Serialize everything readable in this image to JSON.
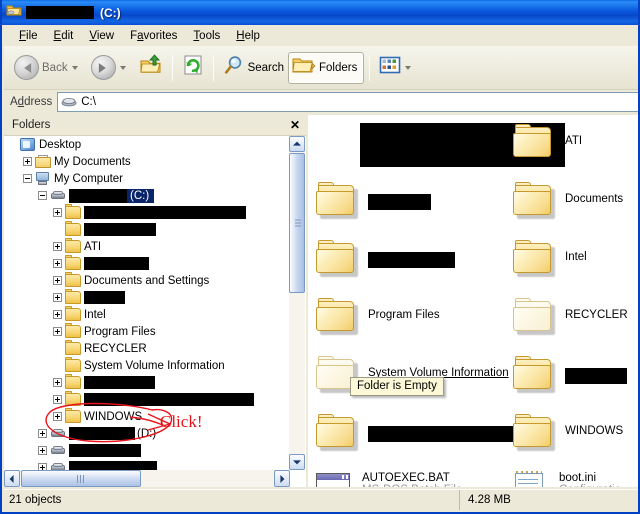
{
  "window": {
    "title_suffix": "(C:)",
    "title_icon": "folder-drive-icon",
    "redacted_title_width": 68
  },
  "menubar": {
    "items": [
      {
        "accel": "F",
        "rest": "ile"
      },
      {
        "accel": "E",
        "rest": "dit"
      },
      {
        "accel": "V",
        "rest": "iew"
      },
      {
        "pre": "F",
        "accel": "a",
        "rest": "vorites"
      },
      {
        "accel": "T",
        "rest": "ools"
      },
      {
        "accel": "H",
        "rest": "elp"
      }
    ],
    "labels": [
      "File",
      "Edit",
      "View",
      "Favorites",
      "Tools",
      "Help"
    ]
  },
  "toolbar": {
    "back_label": "Back",
    "forward_label": "",
    "up_label": "",
    "refresh_label": "",
    "search_label": "Search",
    "folders_label": "Folders",
    "views_label": ""
  },
  "address": {
    "label_pre": "A",
    "label_accel": "d",
    "label_rest": "dress",
    "label": "Address",
    "value": "C:\\",
    "icon": "drive-icon"
  },
  "tree": {
    "header": "Folders",
    "close_label": "✕",
    "nodes": [
      {
        "indent": 0,
        "expander": "none",
        "icon": "desktop-icon",
        "label": "Desktop",
        "redacted": 0,
        "selected": false
      },
      {
        "indent": 1,
        "expander": "plus",
        "icon": "mydocs-icon",
        "label": "My Documents",
        "redacted": 0,
        "selected": false
      },
      {
        "indent": 1,
        "expander": "minus",
        "icon": "mycomputer-icon",
        "label": "My Computer",
        "redacted": 0,
        "selected": false
      },
      {
        "indent": 2,
        "expander": "minus",
        "icon": "drive-icon",
        "label": "(C:)",
        "redacted": 58,
        "selected": true
      },
      {
        "indent": 3,
        "expander": "plus",
        "icon": "folder-icon",
        "label": "",
        "redacted": 162,
        "selected": false
      },
      {
        "indent": 3,
        "expander": "none",
        "icon": "folder-icon",
        "label": "",
        "redacted": 72,
        "selected": false
      },
      {
        "indent": 3,
        "expander": "plus",
        "icon": "folder-icon",
        "label": "ATI",
        "redacted": 0,
        "selected": false
      },
      {
        "indent": 3,
        "expander": "plus",
        "icon": "folder-icon",
        "label": "",
        "redacted": 65,
        "selected": false
      },
      {
        "indent": 3,
        "expander": "plus",
        "icon": "folder-icon",
        "label": "Documents and Settings",
        "redacted": 0,
        "selected": false
      },
      {
        "indent": 3,
        "expander": "plus",
        "icon": "folder-icon",
        "label": "",
        "redacted": 41,
        "selected": false
      },
      {
        "indent": 3,
        "expander": "plus",
        "icon": "folder-icon",
        "label": "Intel",
        "redacted": 0,
        "selected": false
      },
      {
        "indent": 3,
        "expander": "plus",
        "icon": "folder-icon",
        "label": "Program Files",
        "redacted": 0,
        "selected": false
      },
      {
        "indent": 3,
        "expander": "none",
        "icon": "folder-icon",
        "label": "RECYCLER",
        "redacted": 0,
        "selected": false
      },
      {
        "indent": 3,
        "expander": "none",
        "icon": "folder-icon",
        "label": "System Volume Information",
        "redacted": 0,
        "selected": false
      },
      {
        "indent": 3,
        "expander": "plus",
        "icon": "folder-icon",
        "label": "",
        "redacted": 71,
        "selected": false
      },
      {
        "indent": 3,
        "expander": "plus",
        "icon": "folder-icon",
        "label": "",
        "redacted": 170,
        "selected": false
      },
      {
        "indent": 3,
        "expander": "plus",
        "icon": "folder-icon",
        "label": "WINDOWS",
        "redacted": 0,
        "selected": false
      },
      {
        "indent": 2,
        "expander": "plus",
        "icon": "drive-icon",
        "label": "(D:)",
        "redacted": 66,
        "selected": false
      },
      {
        "indent": 2,
        "expander": "plus",
        "icon": "drive-icon",
        "label": "",
        "redacted": 72,
        "selected": false
      },
      {
        "indent": 2,
        "expander": "plus",
        "icon": "drive-icon",
        "label": "",
        "redacted": 88,
        "selected": false
      }
    ]
  },
  "files": {
    "items": [
      {
        "col": 0,
        "row": 0,
        "name": "",
        "redacted": 205,
        "pale": false,
        "underline": false,
        "kind": "folder"
      },
      {
        "col": 1,
        "row": 0,
        "name": "ATI",
        "redacted": 0,
        "pale": false,
        "underline": false,
        "kind": "folder"
      },
      {
        "col": 0,
        "row": 1,
        "name": "",
        "redacted": 63,
        "pale": false,
        "underline": false,
        "kind": "folder"
      },
      {
        "col": 1,
        "row": 1,
        "name": "Documents ",
        "redacted": 0,
        "pale": false,
        "underline": false,
        "kind": "folder"
      },
      {
        "col": 0,
        "row": 2,
        "name": "",
        "redacted": 87,
        "pale": false,
        "underline": false,
        "kind": "folder"
      },
      {
        "col": 1,
        "row": 2,
        "name": "Intel",
        "redacted": 0,
        "pale": false,
        "underline": false,
        "kind": "folder"
      },
      {
        "col": 0,
        "row": 3,
        "name": "Program Files",
        "redacted": 0,
        "pale": false,
        "underline": false,
        "kind": "folder"
      },
      {
        "col": 1,
        "row": 3,
        "name": "RECYCLER",
        "redacted": 0,
        "pale": true,
        "underline": false,
        "kind": "folder"
      },
      {
        "col": 0,
        "row": 4,
        "name": "System Volume Information",
        "redacted": 0,
        "pale": true,
        "underline": true,
        "kind": "folder"
      },
      {
        "col": 1,
        "row": 4,
        "name": "",
        "redacted": 62,
        "pale": false,
        "underline": false,
        "kind": "folder"
      },
      {
        "col": 0,
        "row": 5,
        "name": "",
        "redacted": 147,
        "pale": false,
        "underline": false,
        "kind": "folder"
      },
      {
        "col": 1,
        "row": 5,
        "name": "WINDOWS",
        "redacted": 0,
        "pale": false,
        "underline": false,
        "kind": "folder"
      },
      {
        "col": 0,
        "row": 6,
        "name": "AUTOEXEC.BAT",
        "sub": "MS-DOS Batch File",
        "redacted": 0,
        "pale": false,
        "underline": false,
        "kind": "bat"
      },
      {
        "col": 1,
        "row": 6,
        "name": "boot.ini",
        "sub": "Configuratio",
        "redacted": 0,
        "pale": false,
        "underline": false,
        "kind": "ini"
      }
    ]
  },
  "tooltip": {
    "text": "Folder is Empty"
  },
  "annotation": {
    "click_text": "Click!",
    "color": "#e8141b"
  },
  "statusbar": {
    "left": "21 objects",
    "right": "4.28 MB"
  }
}
